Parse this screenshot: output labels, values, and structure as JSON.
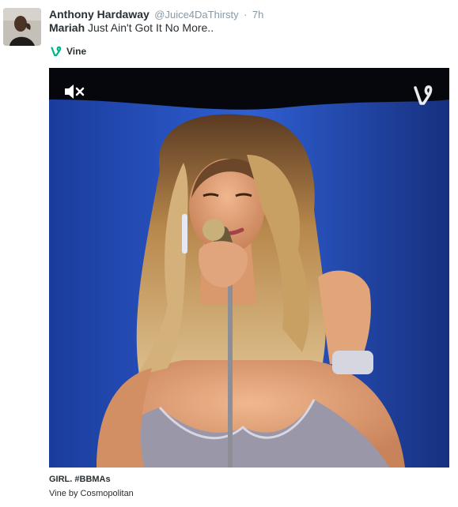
{
  "tweet": {
    "author_name": "Anthony Hardaway",
    "author_handle": "@Juice4DaThirsty",
    "separator": "·",
    "time": "7h",
    "text_bold": "Mariah",
    "text_rest": " Just Ain't Got It No More.."
  },
  "card": {
    "source_label": "Vine",
    "caption": "GIRL. #BBMAs",
    "byline": "Vine by Cosmopolitan"
  },
  "icons": {
    "vine": "vine-logo-icon",
    "mute": "muted-speaker-icon",
    "watermark": "vine-watermark-icon"
  },
  "colors": {
    "vine_green": "#00b489",
    "meta_gray": "#8899a6",
    "text": "#292f33",
    "stage_blue": "#1d3fa0"
  }
}
